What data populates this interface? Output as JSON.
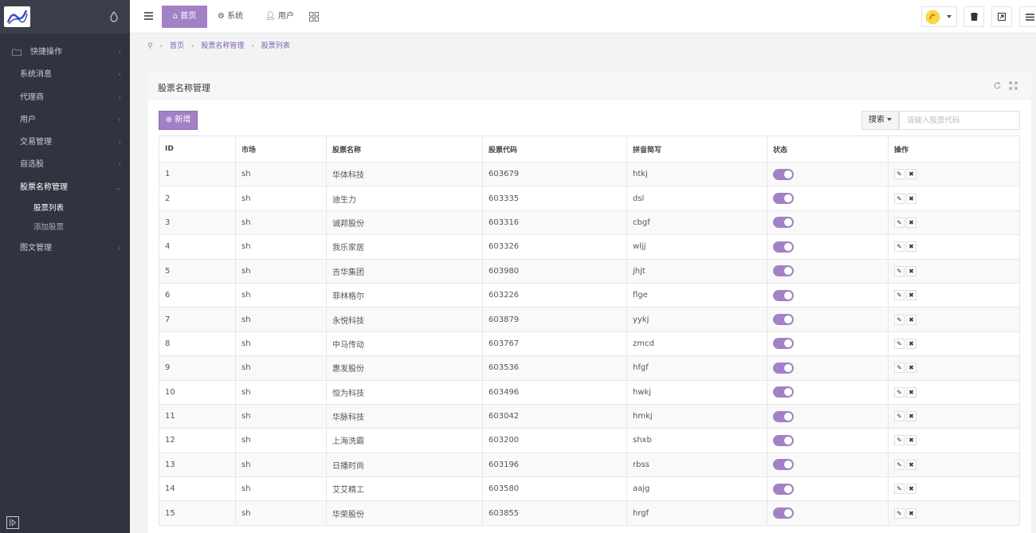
{
  "sidebar": {
    "items": [
      {
        "label": "快捷操作"
      },
      {
        "label": "系统消息"
      },
      {
        "label": "代理商"
      },
      {
        "label": "用户"
      },
      {
        "label": "交易管理"
      },
      {
        "label": "自选股"
      },
      {
        "label": "股票名称管理"
      },
      {
        "label": "图文管理"
      }
    ],
    "submenu": [
      "股票列表",
      "添加股票"
    ]
  },
  "topbar": {
    "home": "首页",
    "system": "系统",
    "user": "用户"
  },
  "breadcrumb": [
    "首页",
    "股票名称管理",
    "股票列表"
  ],
  "panel": {
    "title": "股票名称管理",
    "add_label": "新增",
    "search_label": "搜索",
    "search_placeholder": "请输入股票代码"
  },
  "table": {
    "headers": [
      "ID",
      "市场",
      "股票名称",
      "股票代码",
      "拼音简写",
      "状态",
      "操作"
    ],
    "rows": [
      [
        "1",
        "sh",
        "华体科技",
        "603679",
        "htkj"
      ],
      [
        "2",
        "sh",
        "迪生力",
        "603335",
        "dsl"
      ],
      [
        "3",
        "sh",
        "诚邦股份",
        "603316",
        "cbgf"
      ],
      [
        "4",
        "sh",
        "我乐家居",
        "603326",
        "wljj"
      ],
      [
        "5",
        "sh",
        "吉华集团",
        "603980",
        "jhjt"
      ],
      [
        "6",
        "sh",
        "菲林格尔",
        "603226",
        "flge"
      ],
      [
        "7",
        "sh",
        "永悦科技",
        "603879",
        "yykj"
      ],
      [
        "8",
        "sh",
        "中马传动",
        "603767",
        "zmcd"
      ],
      [
        "9",
        "sh",
        "惠发股份",
        "603536",
        "hfgf"
      ],
      [
        "10",
        "sh",
        "恒为科技",
        "603496",
        "hwkj"
      ],
      [
        "11",
        "sh",
        "华脉科技",
        "603042",
        "hmkj"
      ],
      [
        "12",
        "sh",
        "上海洗霸",
        "603200",
        "shxb"
      ],
      [
        "13",
        "sh",
        "日播时尚",
        "603196",
        "rbss"
      ],
      [
        "14",
        "sh",
        "艾艾精工",
        "603580",
        "aajg"
      ],
      [
        "15",
        "sh",
        "华荣股份",
        "603855",
        "hrgf"
      ]
    ]
  },
  "colors": {
    "accent": "#a281c6",
    "sidebar": "#2f3440"
  }
}
